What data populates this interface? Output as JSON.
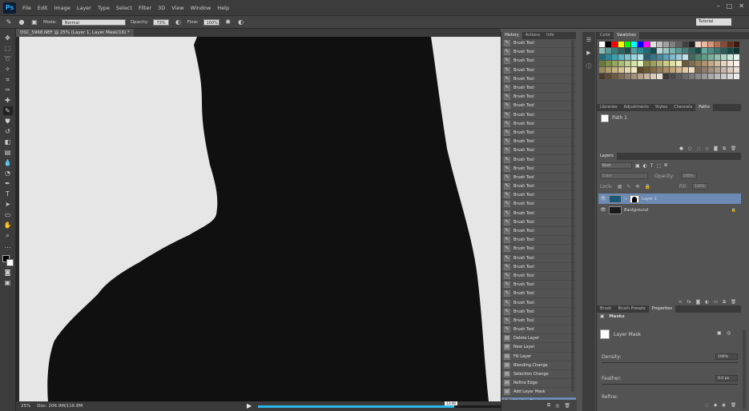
{
  "app": {
    "logo": "Ps"
  },
  "menu": [
    "File",
    "Edit",
    "Image",
    "Layer",
    "Type",
    "Select",
    "Filter",
    "3D",
    "View",
    "Window",
    "Help"
  ],
  "options": {
    "mode_label": "Mode:",
    "mode_value": "Normal",
    "opacity_label": "Opacity:",
    "opacity_value": "73%",
    "flow_label": "Flow:",
    "flow_value": "100%",
    "workspace": "Tutorial"
  },
  "document": {
    "tab": "DSC_5968.NEF @ 25% (Layer 1, Layer Mask/16) *",
    "zoom": "25%",
    "doc_info": "Doc: 206.9M/116.8M"
  },
  "video": {
    "time": "13:49",
    "progress": 0.81,
    "hd_label": "HD"
  },
  "history": {
    "tabs": [
      "History",
      "Actions",
      "Info"
    ],
    "items": [
      "Brush Tool",
      "Brush Tool",
      "Brush Tool",
      "Brush Tool",
      "Brush Tool",
      "Brush Tool",
      "Brush Tool",
      "Brush Tool",
      "Brush Tool",
      "Brush Tool",
      "Brush Tool",
      "Brush Tool",
      "Brush Tool",
      "Brush Tool",
      "Brush Tool",
      "Brush Tool",
      "Brush Tool",
      "Brush Tool",
      "Brush Tool",
      "Brush Tool",
      "Brush Tool",
      "Brush Tool",
      "Brush Tool",
      "Brush Tool",
      "Brush Tool",
      "Brush Tool",
      "Brush Tool",
      "Brush Tool",
      "Brush Tool",
      "Brush Tool",
      "Brush Tool",
      "Brush Tool",
      "Brush Tool",
      "Delete Layer",
      "New Layer",
      "Fill Layer",
      "Blending Change",
      "Selection Change",
      "Refine Edge",
      "Add Layer Mask",
      "Healing Brush"
    ],
    "active_index": 40
  },
  "swatches_panel": {
    "tabs": [
      "Color",
      "Swatches"
    ],
    "colors": [
      "#ffffff",
      "#000000",
      "#ff0000",
      "#ffff00",
      "#00ff00",
      "#00ffff",
      "#0000ff",
      "#ff00ff",
      "#e0e0e0",
      "#c0c0c0",
      "#a0a0a0",
      "#808080",
      "#606060",
      "#404040",
      "#202020",
      "#f4d6c6",
      "#e9b9a2",
      "#d9967a",
      "#b86f4f",
      "#8a4b32",
      "#5e2f1d",
      "#3b1b10",
      "#8ab8b4",
      "#5b9b96",
      "#3b7d78",
      "#2a6460",
      "#1c4d49",
      "#4f9fa6",
      "#2f8790",
      "#1d6b73",
      "#104f56",
      "#b9d9d6",
      "#99c8c3",
      "#79b3ad",
      "#5d9993",
      "#45807a",
      "#2d6560",
      "#184c47",
      "#6aa6a0",
      "#4f8e88",
      "#397670",
      "#275e59",
      "#174843",
      "#0b3430",
      "#1f6d7a",
      "#2d8796",
      "#3ba1b1",
      "#5ab4c1",
      "#7ac6d0",
      "#9ad6de",
      "#bde6ea",
      "#2a5e73",
      "#34748c",
      "#408aa5",
      "#5ea0b8",
      "#7fb6ca",
      "#a0cbdb",
      "#c2e0ea",
      "#3f6b5a",
      "#4f8470",
      "#609c86",
      "#79b09b",
      "#93c3b0",
      "#aed6c6",
      "#c9e8dc",
      "#e3f4ee",
      "#6a7a3a",
      "#7f914a",
      "#94a85c",
      "#a9bd71",
      "#bed188",
      "#d2e3a3",
      "#e5f2c1",
      "#8a8a4a",
      "#a0a05c",
      "#b6b670",
      "#cbcb87",
      "#dfdfa1",
      "#efefbd",
      "#6a5a3a",
      "#806d4a",
      "#96805c",
      "#ac9470",
      "#c1a887",
      "#d4bda1",
      "#e6d3be",
      "#f2e6d8",
      "#faf2ea",
      "#9a8a5a",
      "#b09e6c",
      "#c6b27f",
      "#d8c594",
      "#e8d8ab",
      "#f3e8c6",
      "#5a4a2a",
      "#6e5b36",
      "#836c44",
      "#977d53",
      "#ab8f64",
      "#bfa277",
      "#d2b58c",
      "#e3c9a4",
      "#f1ddbf",
      "#7a6a5a",
      "#8e7d6c",
      "#a1907f",
      "#b4a393",
      "#c7b7a8",
      "#d9cbbe",
      "#eadfd5",
      "#4a3a2a",
      "#5c4a38",
      "#6e5a47",
      "#806b57",
      "#927d68",
      "#a48f7b",
      "#b6a28e",
      "#c8b6a3",
      "#d9cab9",
      "#e9ded1",
      "#3a3a3a",
      "#4a4a4a",
      "#5a5a5a",
      "#6a6a6a",
      "#7a7a7a",
      "#8a8a8a",
      "#9a9a9a",
      "#aaaaaa",
      "#bababa",
      "#cacaca",
      "#dadada",
      "#eaeaea"
    ]
  },
  "paths_panel": {
    "tabs": [
      "Libraries",
      "Adjustments",
      "Styles",
      "Channels",
      "Paths"
    ],
    "items": [
      "Path 1"
    ]
  },
  "layers_panel": {
    "title": "Layers",
    "kind_label": "Kind",
    "blend_label": "Color",
    "opacity_label": "Opacity:",
    "opacity_value": "100%",
    "lock_label": "Lock:",
    "fill_label": "Fill:",
    "fill_value": "100%",
    "layers": [
      {
        "name": "Layer 1",
        "thumb": "#1d5877",
        "active": true
      },
      {
        "name": "Background",
        "thumb": "#1a1a1a",
        "active": false
      }
    ]
  },
  "properties_panel": {
    "tabs": [
      "Brush",
      "Brush Presets",
      "Properties"
    ],
    "section": "Masks",
    "mask_type": "Layer Mask",
    "density_label": "Density:",
    "density_value": "100%",
    "feather_label": "Feather:",
    "feather_value": "0.0 px",
    "refine_label": "Refine:"
  }
}
